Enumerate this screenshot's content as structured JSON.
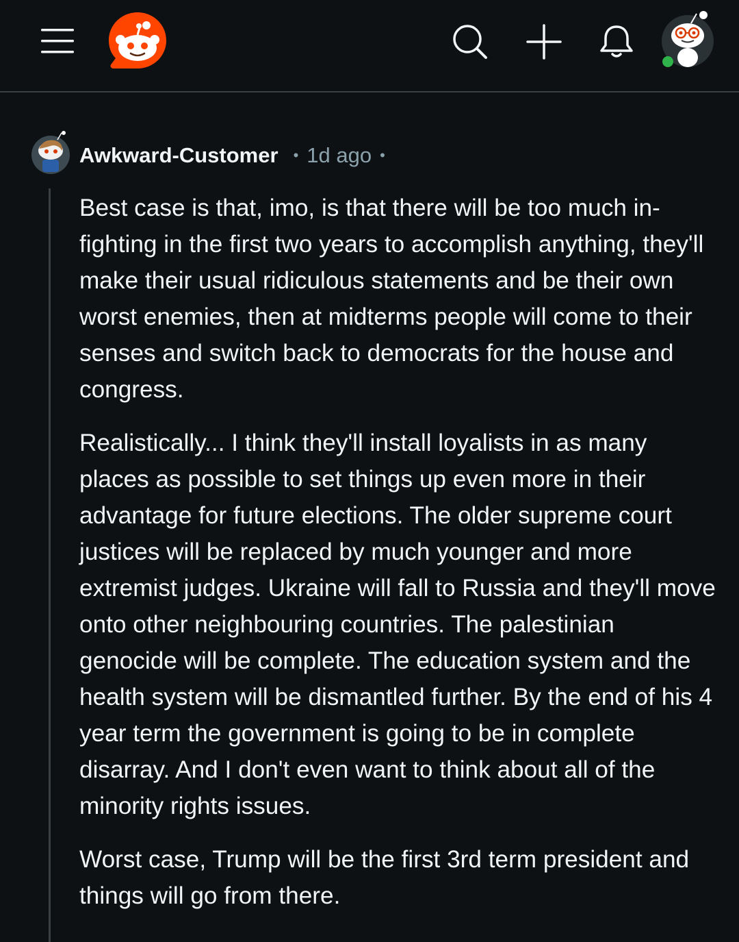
{
  "header": {
    "menu_icon": "hamburger-menu-icon",
    "logo_icon": "reddit-snoo-logo",
    "search_icon": "search-icon",
    "create_icon": "plus-icon",
    "notifications_icon": "bell-icon",
    "profile_avatar": "snoo-avatar",
    "online_status_color": "#2fb34a"
  },
  "comment": {
    "author": "Awkward-Customer",
    "separator": "•",
    "time": "1d ago",
    "paragraphs": [
      "Best case is that, imo, is that there will be too much in-fighting in the first two years to accomplish anything, they'll make their usual ridiculous statements and be their own worst enemies, then at midterms people will come to their senses and switch back to democrats for the house and congress.",
      "Realistically... I think they'll install loyalists in as many places as possible to set things up even more in their advantage for future elections. The older supreme court justices will be replaced by much younger and more extremist judges. Ukraine will fall to Russia and they'll move onto other neighbouring countries. The palestinian genocide will be complete. The education system and the health system will be dismantled further. By the end of his 4 year term the government is going to be in complete disarray. And I don't even want to think about all of the minority rights issues.",
      "Worst case, Trump will be the first 3rd term president and things will go from there."
    ]
  },
  "colors": {
    "background": "#0e1113",
    "text": "#f2f4f5",
    "muted": "#8ba2ad",
    "brand": "#ff4500"
  }
}
